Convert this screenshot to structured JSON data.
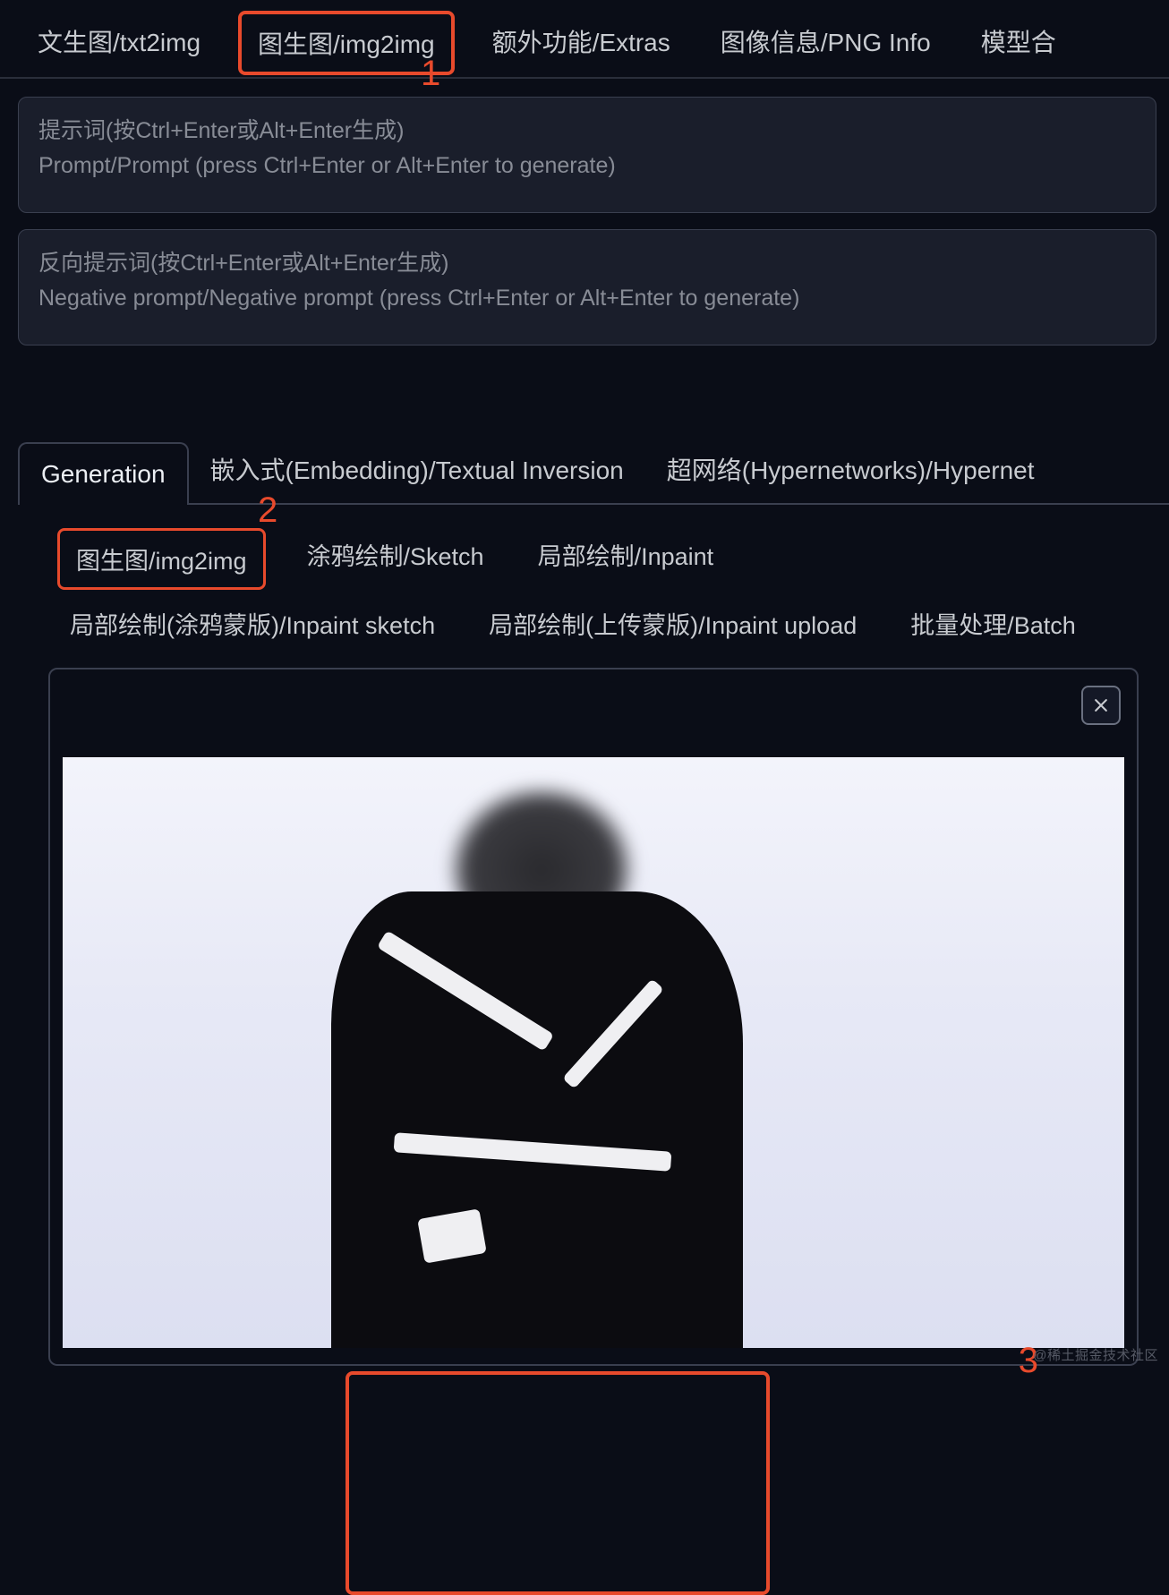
{
  "top_tabs": {
    "txt2img": "文生图/txt2img",
    "img2img": "图生图/img2img",
    "extras": "额外功能/Extras",
    "png_info": "图像信息/PNG Info",
    "model_merge": "模型合"
  },
  "prompts": {
    "positive_cn": "提示词(按Ctrl+Enter或Alt+Enter生成)",
    "positive_en": "Prompt/Prompt (press Ctrl+Enter or Alt+Enter to generate)",
    "negative_cn": "反向提示词(按Ctrl+Enter或Alt+Enter生成)",
    "negative_en": "Negative prompt/Negative prompt (press Ctrl+Enter or Alt+Enter to generate)"
  },
  "mid_tabs": {
    "generation": "Generation",
    "embedding": "嵌入式(Embedding)/Textual Inversion",
    "hypernet": "超网络(Hypernetworks)/Hypernet"
  },
  "sub_tabs": {
    "img2img": "图生图/img2img",
    "sketch": "涂鸦绘制/Sketch",
    "inpaint": "局部绘制/Inpaint",
    "inpaint_sketch": "局部绘制(涂鸦蒙版)/Inpaint sketch",
    "inpaint_upload": "局部绘制(上传蒙版)/Inpaint upload",
    "batch": "批量处理/Batch"
  },
  "annotations": {
    "n1": "1",
    "n2": "2",
    "n3": "3"
  },
  "watermark": "@稀土掘金技术社区"
}
